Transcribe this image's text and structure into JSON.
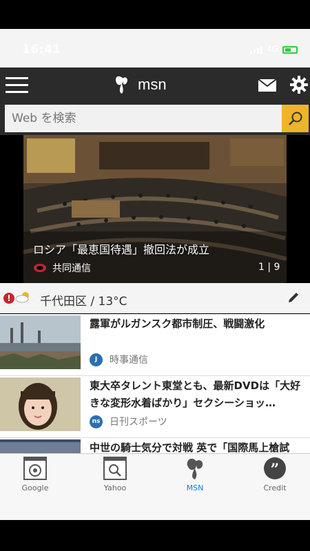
{
  "status": {
    "time": "16:41",
    "network": "4G"
  },
  "header": {
    "app_name": "msn"
  },
  "search": {
    "placeholder": "Web を検索"
  },
  "hero": {
    "title": "ロシア「最恵国待遇」撤回法が成立",
    "source": "共同通信",
    "page": "1 | 9"
  },
  "weather": {
    "location_temp": "千代田区 / 13°C"
  },
  "news": [
    {
      "title": "露軍がルガンスク都市制圧、戦闘激化",
      "source": "時事通信"
    },
    {
      "title": "東大卒タレント東堂とも、最新DVDは「大好きな変形水着ばかり」セクシーショッ…",
      "source": "日刊スポーツ"
    },
    {
      "title": "中世の騎士気分で対戦 英で「国際馬上槍試",
      "source": ""
    }
  ],
  "tabs": [
    {
      "label": "Google",
      "icon": "google-tab-icon"
    },
    {
      "label": "Yahoo",
      "icon": "yahoo-tab-icon"
    },
    {
      "label": "MSN",
      "icon": "msn-tab-icon"
    },
    {
      "label": "Credit",
      "icon": "credit-tab-icon"
    }
  ],
  "colors": {
    "header": "#2b2b2b",
    "search_button": "#f0b429",
    "tab_active": "#1a7bd5",
    "alert": "#c6262e"
  }
}
